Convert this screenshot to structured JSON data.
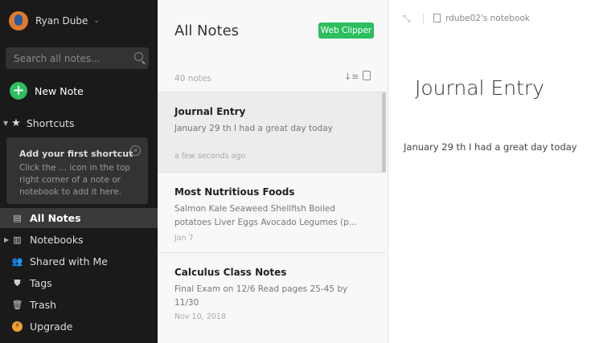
{
  "sidebar": {
    "user_name": "Ryan Dube",
    "search_placeholder": "Search all notes...",
    "new_note_label": "New Note",
    "shortcuts_label": "Shortcuts",
    "tip": {
      "title": "Add your first shortcut",
      "body": "Click the ... icon in the top right corner of a note or notebook to add it here."
    },
    "items": [
      {
        "label": "All Notes",
        "icon": "all-notes-icon",
        "active": true
      },
      {
        "label": "Notebooks",
        "icon": "notebooks-icon"
      },
      {
        "label": "Shared with Me",
        "icon": "shared-icon"
      },
      {
        "label": "Tags",
        "icon": "tag-icon"
      },
      {
        "label": "Trash",
        "icon": "trash-icon"
      },
      {
        "label": "Upgrade",
        "icon": "upgrade-icon"
      }
    ]
  },
  "list": {
    "title": "All Notes",
    "clipper_label": "Web Clipper",
    "count": "40 notes",
    "notes": [
      {
        "title": "Journal Entry",
        "snippet": "January 29 th I had a great day today",
        "date": "a few seconds ago"
      },
      {
        "title": "Most Nutritious Foods",
        "snippet": "Salmon Kale Seaweed Shellfish Boiled potatoes Liver Eggs Avocado Legumes (p...",
        "date": "Jan 7"
      },
      {
        "title": "Calculus Class Notes",
        "snippet": "Final Exam on 12/6 Read pages 25-45 by 11/30",
        "date": "Nov 10, 2018"
      }
    ]
  },
  "editor": {
    "notebook_label": "rdube02's notebook",
    "title": "Journal Entry",
    "body": "January 29 th I had a great day today"
  },
  "colors": {
    "accent": "#2dbe60",
    "sidebar_bg": "#1a1a1a"
  }
}
